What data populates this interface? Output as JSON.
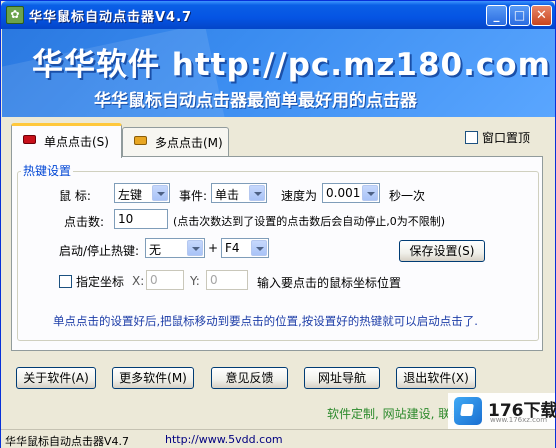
{
  "window": {
    "title": "华华鼠标自动点击器V4.7",
    "min_glyph": "_",
    "max_glyph": "□",
    "close_glyph": "✕"
  },
  "banner": {
    "title": "华华软件 http://pc.mz180.com",
    "subtitle": "华华鼠标自动点击器最简单最好用的点击器"
  },
  "tabs": [
    {
      "label": "单点点击(S)",
      "active": true,
      "icon": "red-square-icon"
    },
    {
      "label": "多点点击(M)",
      "active": false,
      "icon": "orange-square-icon"
    }
  ],
  "topmost": {
    "label": "窗口置顶",
    "checked": false
  },
  "hotkey_group": {
    "legend": "热键设置",
    "mouse_label": "鼠 标:",
    "mouse_value": "左键",
    "event_label": "事件:",
    "event_value": "单击",
    "speed_label": "速度为",
    "speed_value": "0.001",
    "speed_unit": "秒一次",
    "count_label": "点击数:",
    "count_value": "10",
    "count_hint": "(点击次数达到了设置的点击数后会自动停止,0为不限制)",
    "hotkey_label": "启动/停止热键:",
    "hotkey_mod": "无",
    "plus": "+",
    "hotkey_key": "F4",
    "save_button": "保存设置(S)",
    "coord_checkbox_label": "指定坐标",
    "coord_checked": false,
    "x_label": "X:",
    "x_value": "0",
    "y_label": "Y:",
    "y_value": "0",
    "coord_hint": "输入要点击的鼠标坐标位置",
    "note": "单点点击的设置好后,把鼠标移动到要点击的位置,按设置好的热键就可以启动点击了."
  },
  "bottom_buttons": {
    "about": "关于软件(A)",
    "more": "更多软件(M)",
    "feedback": "意见反馈",
    "nav": "网址导航",
    "exit": "退出软件(X)"
  },
  "footer": {
    "green_text": "软件定制, 网站建设, 联系",
    "status_name": "华华鼠标自动点击器V4.7",
    "status_url": "http://www.5vdd.com"
  },
  "watermark": {
    "text": "176下载网",
    "sub": "www.176xz.com"
  }
}
